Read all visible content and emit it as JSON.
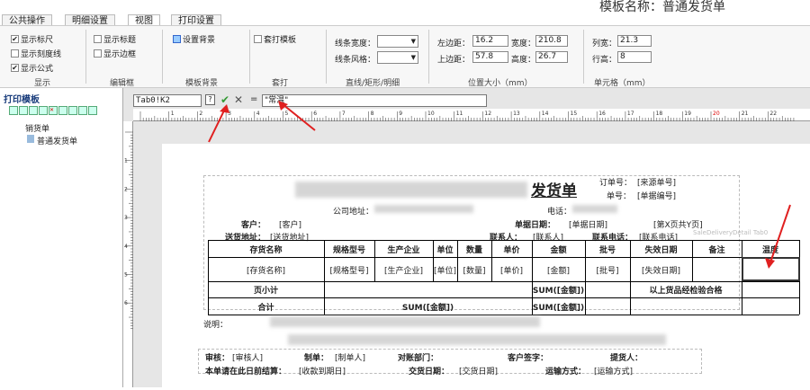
{
  "tabs": [
    "公共操作",
    "明细设置",
    "视图",
    "打印设置"
  ],
  "template_title": "模板名称：普通发货单",
  "ribbon": {
    "display": {
      "checks": [
        {
          "label": "显示标尺",
          "checked": true
        },
        {
          "label": "显示刻度线",
          "checked": false
        },
        {
          "label": "显示公式",
          "checked": true
        }
      ],
      "caption": "显示"
    },
    "edit": {
      "checks": [
        {
          "label": "显示标题",
          "checked": false
        },
        {
          "label": "显示边框",
          "checked": false
        }
      ],
      "caption": "编辑框"
    },
    "bg": {
      "button": "设置背景",
      "caption": "模板背景"
    },
    "overlay": {
      "check": "套打模板",
      "caption": "套打"
    },
    "line": {
      "width_label": "线条宽度：",
      "style_label": "线条风格：",
      "caption": "直线/矩形/明细"
    },
    "pos": {
      "left_label": "左边距：",
      "left": "16.2",
      "top_label": "上边距：",
      "top": "57.8",
      "width_label": "宽度：",
      "width": "210.8",
      "height_label": "高度：",
      "height": "26.7",
      "caption": "位置大小（mm）"
    },
    "cell": {
      "col_label": "列宽：",
      "col": "21.3",
      "row_label": "行高：",
      "row": "8",
      "caption": "单元格（mm）"
    }
  },
  "left": {
    "title": "打印模板",
    "tree_parent": "销货单",
    "tree_child": "普通发货单"
  },
  "formula": {
    "cellref": "Tab0!K2",
    "value": "\"常温\""
  },
  "ruler_h": [
    "1",
    "2",
    "3",
    "4",
    "5",
    "6",
    "7",
    "8",
    "9",
    "10",
    "11",
    "12",
    "13",
    "14",
    "15",
    "16",
    "17",
    "18",
    "19",
    "20",
    "21",
    "22"
  ],
  "ruler_v": [
    "1",
    "2",
    "3",
    "4",
    "5",
    "6"
  ],
  "doc": {
    "title": "发货单",
    "order_no_label": "订单号：",
    "order_no": "[来源单号]",
    "bill_no_label": "单号：",
    "bill_no": "[单据编号]",
    "addr_label": "公司地址：",
    "tel_label": "电话：",
    "customer_label": "客户：",
    "customer": "[客户]",
    "bill_date_label": "单据日期：",
    "bill_date": "[单据日期]",
    "page": "[第X页共Y页]",
    "ship_addr_label": "送货地址：",
    "ship_addr": "[送货地址]",
    "contact_label": "联系人：",
    "contact": "[联系人]",
    "contact_tel_label": "联系电话：",
    "contact_tel": "[联系电话]",
    "table_hint": "SaleDeliveryDetail Tab0",
    "headers": [
      "存货名称",
      "规格型号",
      "生产企业",
      "单位",
      "数量",
      "单价",
      "金额",
      "批号",
      "失效日期",
      "备注",
      "温度"
    ],
    "row": [
      "[存货名称]",
      "[规格型号]",
      "[生产企业]",
      "[单位]",
      "[数量]",
      "[单价]",
      "[金额]",
      "[批号]",
      "[失效日期]",
      "",
      ""
    ],
    "subtotal_label": "页小计",
    "subtotal_formula": "SUM([金额])",
    "qc_note": "以上货品经检验合格",
    "total_label": "合计",
    "total_formula": "SUM([金额])",
    "total_formula2": "SUM([金额])",
    "note_label": "说明：",
    "reviewer_label": "审核：",
    "reviewer": "[审核人]",
    "maker_label": "制单：",
    "maker": "[制单人]",
    "dept_label": "对账部门：",
    "sign_label": "客户签字：",
    "picker_label": "提货人：",
    "settle_label": "本单请在此日前结算：",
    "settle": "[收款到期日]",
    "deliver_label": "交货日期：",
    "deliver": "[交货日期]",
    "transport_label": "运输方式：",
    "transport": "[运输方式]"
  }
}
